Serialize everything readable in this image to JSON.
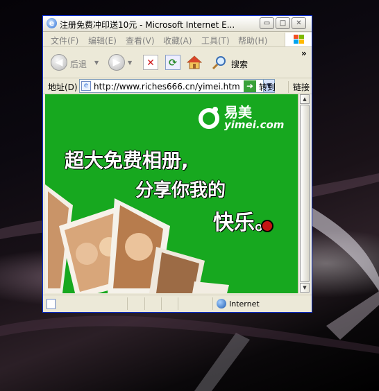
{
  "window": {
    "title": "注册免费冲印送10元 - Microsoft Internet E...",
    "controls": {
      "minimize": "▭",
      "maximize": "□",
      "close": "✕"
    }
  },
  "menu": {
    "items": [
      "文件(F)",
      "编辑(E)",
      "查看(V)",
      "收藏(A)",
      "工具(T)",
      "帮助(H)"
    ]
  },
  "toolbar": {
    "back_label": "后退",
    "search_label": "搜索",
    "more": "»"
  },
  "address": {
    "label": "地址(D)",
    "url": "http://www.riches666.cn/yimei.htm",
    "go_label": "转到",
    "links_label": "链接"
  },
  "page": {
    "logo_cn": "易美",
    "logo_en": "yimei.com",
    "slogan_line1": "超大免费相册,",
    "slogan_line2": "分享你我的",
    "slogan_line3": "快乐。"
  },
  "status": {
    "zone": "Internet"
  },
  "colors": {
    "content_green": "#17a81f",
    "window_frame": "#ece9d8"
  }
}
